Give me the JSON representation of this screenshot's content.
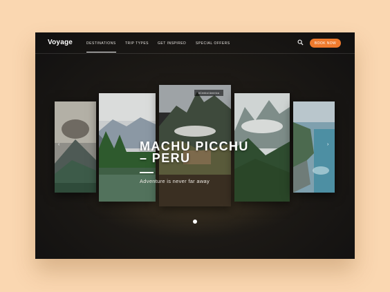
{
  "brand": {
    "logo": "Voyage"
  },
  "nav": {
    "items": [
      {
        "label": "DESTINATIONS",
        "active": true
      },
      {
        "label": "TRIP TYPES",
        "active": false
      },
      {
        "label": "GET INSPIRED",
        "active": false
      },
      {
        "label": "SPECIAL OFFERS",
        "active": false
      }
    ],
    "search_icon": "search-icon",
    "book_label": "BOOK NOW"
  },
  "hero": {
    "title_line1": "MACHU PICCHU",
    "title_line2": "– PERU",
    "subtitle": "Adventure is never far away",
    "featured_tag": "#Central America"
  },
  "carousel": {
    "cards": [
      "volcano",
      "mountain-lake",
      "machu-picchu",
      "misty-mountains",
      "coastal-cliffs"
    ],
    "prev_icon": "chevron-left-icon",
    "next_icon": "chevron-right-icon",
    "active_slide": 1
  },
  "colors": {
    "page_background": "#fad7b1",
    "accent": "#ef7a2d",
    "hero_background": "#1d1a16"
  }
}
